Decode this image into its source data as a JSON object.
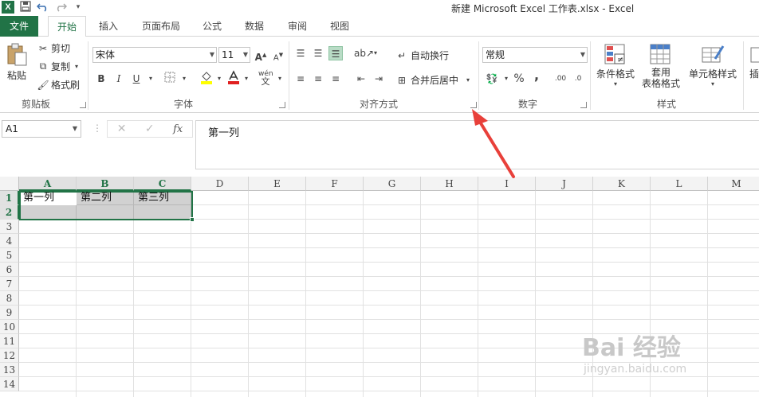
{
  "title_bar": {
    "title": "新建 Microsoft Excel 工作表.xlsx - Excel",
    "app_icon": "X"
  },
  "tabs": [
    {
      "label": "文件"
    },
    {
      "label": "开始"
    },
    {
      "label": "插入"
    },
    {
      "label": "页面布局"
    },
    {
      "label": "公式"
    },
    {
      "label": "数据"
    },
    {
      "label": "审阅"
    },
    {
      "label": "视图"
    }
  ],
  "ribbon": {
    "clipboard": {
      "label": "剪贴板",
      "paste": "粘贴",
      "cut": "剪切",
      "copy": "复制",
      "format_painter": "格式刷"
    },
    "font": {
      "label": "字体",
      "font_name": "宋体",
      "font_size": "11",
      "grow": "A",
      "shrink": "A",
      "bold": "B",
      "italic": "I",
      "underline": "U",
      "phonetic": "wén"
    },
    "alignment": {
      "label": "对齐方式",
      "wrap_text": "自动换行",
      "merge_center": "合并后居中"
    },
    "number": {
      "label": "数字",
      "format": "常规",
      "percent": "%",
      "comma": ","
    },
    "styles": {
      "label": "样式",
      "conditional": "条件格式",
      "format_table_line1": "套用",
      "format_table_line2": "表格格式",
      "cell_styles": "单元格样式",
      "insert": "插"
    }
  },
  "formula_bar": {
    "name_box": "A1",
    "fx": "fx",
    "content": "第一列"
  },
  "grid": {
    "columns": [
      "A",
      "B",
      "C",
      "D",
      "E",
      "F",
      "G",
      "H",
      "I",
      "J",
      "K",
      "L",
      "M"
    ],
    "rows": [
      "1",
      "2",
      "3",
      "4",
      "5",
      "6",
      "7",
      "8",
      "9",
      "10",
      "11",
      "12",
      "13",
      "14"
    ],
    "cells": {
      "A1": "第一列",
      "B1": "第二列",
      "C1": "第三列"
    }
  },
  "watermark": {
    "brand": "Bai 经验",
    "url": "jingyan.baidu.com"
  },
  "colors": {
    "accent": "#217346",
    "arrow": "#e8403a"
  }
}
